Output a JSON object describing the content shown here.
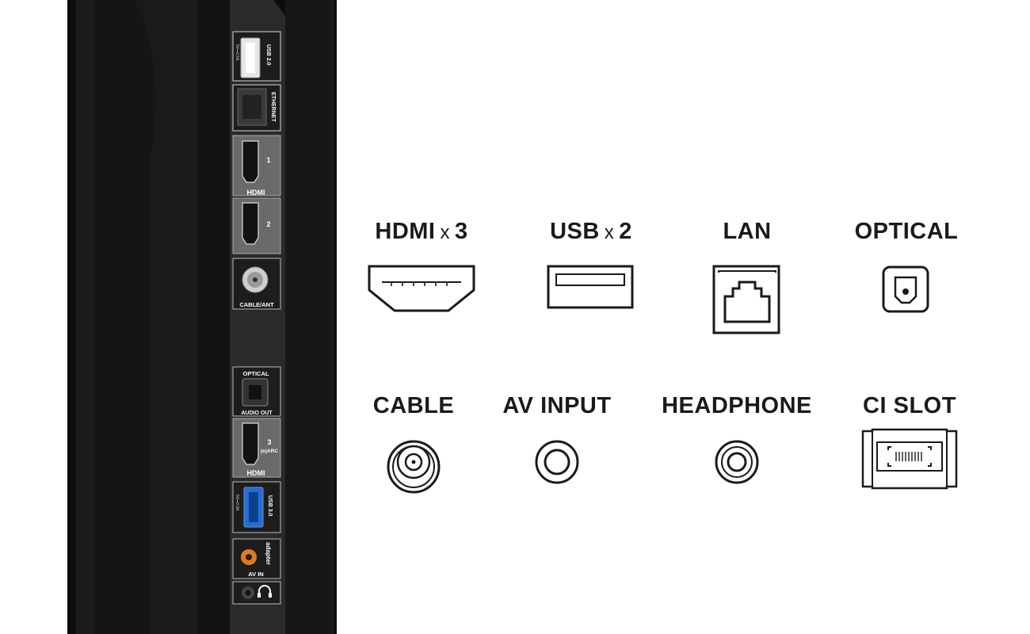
{
  "panel_labels": {
    "usb2_label": "USB 2.0",
    "usb2_rating": "5V⎓0.5A",
    "ethernet_label": "ETHERNET",
    "hdmi1_num": "1",
    "hdmi_logo": "HDMI",
    "hdmi2_num": "2",
    "cable_ant_label": "CABLE/ANT",
    "optical_label": "OPTICAL",
    "audio_out_label": "AUDIO OUT",
    "hdmi3_num": "3",
    "earc_label": "(e)ARC",
    "hdmi_logo_2": "HDMI",
    "usb3_label": "USB 3.0",
    "usb3_rating": "5V⎓0.9A",
    "adapter_label": "adapter",
    "av_in_label": "AV IN"
  },
  "connectors": [
    {
      "id": "hdmi",
      "name": "HDMI",
      "multiplier": "x",
      "count": "3",
      "icon": "hdmi-icon"
    },
    {
      "id": "usb",
      "name": "USB",
      "multiplier": "x",
      "count": "2",
      "icon": "usb-icon"
    },
    {
      "id": "lan",
      "name": "LAN",
      "icon": "lan-icon"
    },
    {
      "id": "optical",
      "name": "OPTICAL",
      "icon": "optical-icon"
    },
    {
      "id": "cable",
      "name": "CABLE",
      "icon": "cable-icon"
    },
    {
      "id": "av-input",
      "name": "AV INPUT",
      "icon": "av-input-icon"
    },
    {
      "id": "headphone",
      "name": "HEADPHONE",
      "icon": "headphone-icon"
    },
    {
      "id": "ci-slot",
      "name": "CI SLOT",
      "icon": "ci-slot-icon"
    }
  ],
  "colors": {
    "background": "#ffffff",
    "tv_body": "#141414",
    "port_panel": "#2b2b2b",
    "usb3_blue": "#1e6fd9",
    "av_orange": "#e07b1a",
    "icon_stroke": "#1a1a1a"
  }
}
